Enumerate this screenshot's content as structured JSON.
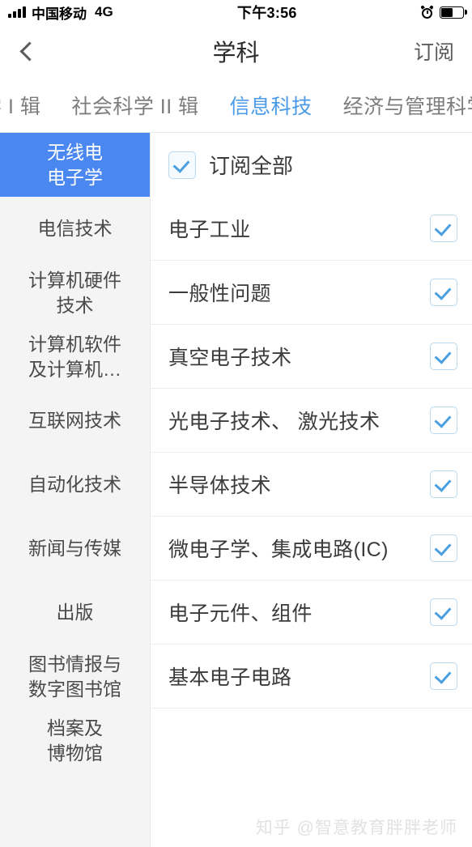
{
  "status_bar": {
    "signal_icon": "signal-bars-icon",
    "carrier": "中国移动",
    "network": "4G",
    "time": "下午3:56",
    "alarm_icon": "alarm-clock-icon",
    "battery_icon": "battery-icon",
    "battery_percent": 55
  },
  "navbar": {
    "back_icon": "chevron-left-icon",
    "title": "学科",
    "action_label": "订阅"
  },
  "tabs": {
    "active_color": "#4a9ae8",
    "items": [
      {
        "label": "学 I 辑",
        "active": false
      },
      {
        "label": "社会科学 II 辑",
        "active": false
      },
      {
        "label": "信息科技",
        "active": true
      },
      {
        "label": "经济与管理科学",
        "active": false
      }
    ]
  },
  "sidebar": {
    "active_bg": "#4a87f0",
    "items": [
      {
        "label": "无线电\n电子学",
        "active": true
      },
      {
        "label": "电信技术",
        "active": false
      },
      {
        "label": "计算机硬件\n技术",
        "active": false
      },
      {
        "label": "计算机软件\n及计算机…",
        "active": false
      },
      {
        "label": "互联网技术",
        "active": false
      },
      {
        "label": "自动化技术",
        "active": false
      },
      {
        "label": "新闻与传媒",
        "active": false
      },
      {
        "label": "出版",
        "active": false
      },
      {
        "label": "图书情报与\n数字图书馆",
        "active": false
      },
      {
        "label": "档案及\n博物馆",
        "active": false
      }
    ]
  },
  "content": {
    "select_all": {
      "label": "订阅全部",
      "checked": true,
      "checkbox_icon": "checkbox-checked-icon"
    },
    "checkbox_border_color": "#b9d9f0",
    "checkbox_tick_color": "#4a9fe0",
    "items": [
      {
        "label": "电子工业",
        "checked": true
      },
      {
        "label": "一般性问题",
        "checked": true
      },
      {
        "label": "真空电子技术",
        "checked": true
      },
      {
        "label": "光电子技术、 激光技术",
        "checked": true
      },
      {
        "label": "半导体技术",
        "checked": true
      },
      {
        "label": "微电子学、集成电路(IC)",
        "checked": true
      },
      {
        "label": "电子元件、组件",
        "checked": true
      },
      {
        "label": "基本电子电路",
        "checked": true
      }
    ]
  },
  "watermark": {
    "text": "知乎 @智意教育胖胖老师"
  }
}
